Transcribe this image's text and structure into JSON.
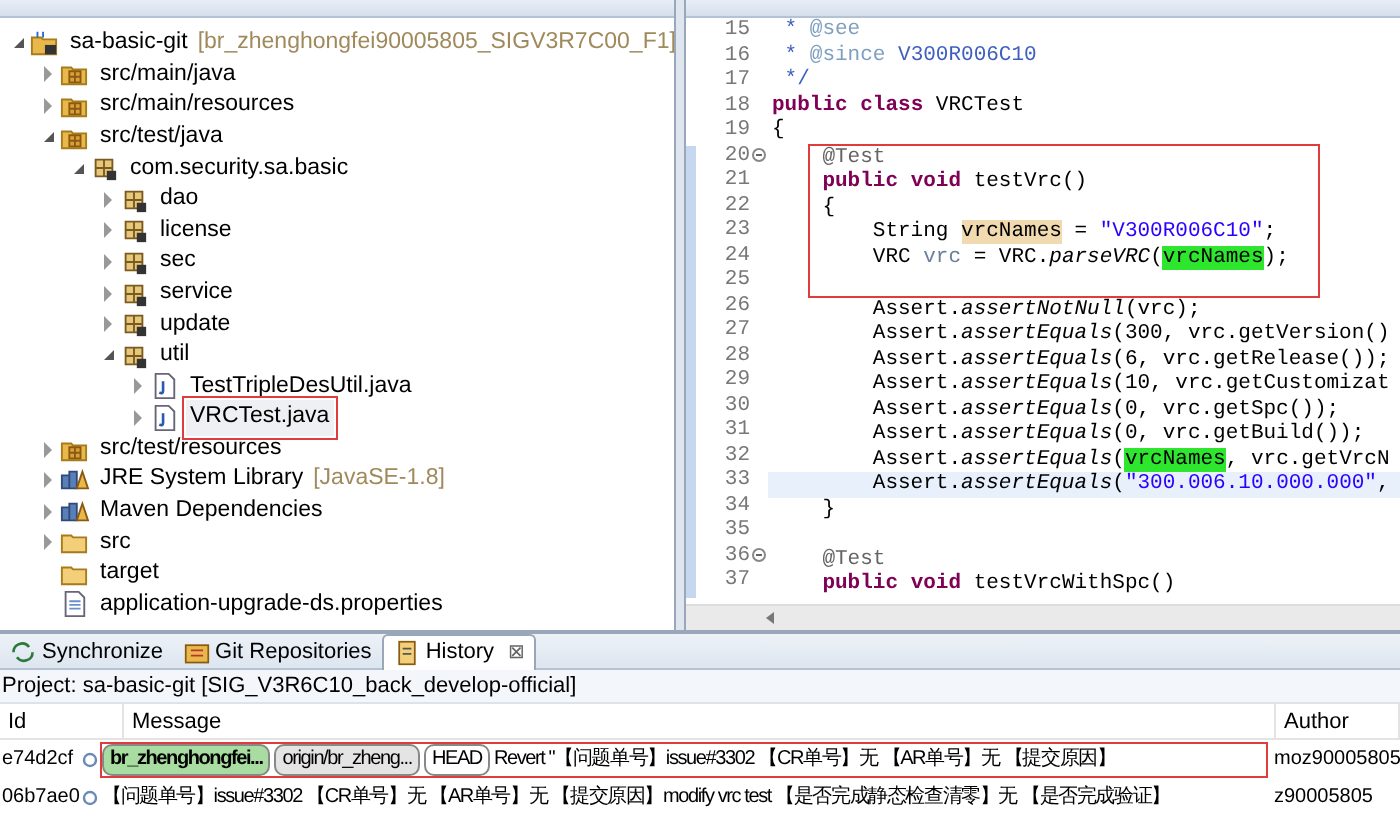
{
  "package_explorer": {
    "tree": [
      {
        "label": "sa-basic-git",
        "suffix": "[br_zhenghongfei90005805_SIGV3R7C00_F1]",
        "kind": "project",
        "expanded": true,
        "boxed": false,
        "children": [
          {
            "label": "src/main/java",
            "kind": "source-folder",
            "expanded": false,
            "boxed": false
          },
          {
            "label": "src/main/resources",
            "kind": "source-folder",
            "expanded": false,
            "boxed": false
          },
          {
            "label": "src/test/java",
            "kind": "source-folder",
            "expanded": true,
            "boxed": false,
            "children": [
              {
                "label": "com.security.sa.basic",
                "kind": "package",
                "expanded": true,
                "boxed": false,
                "children": [
                  {
                    "label": "dao",
                    "kind": "package",
                    "expanded": false,
                    "boxed": false
                  },
                  {
                    "label": "license",
                    "kind": "package",
                    "expanded": false,
                    "boxed": false
                  },
                  {
                    "label": "sec",
                    "kind": "package",
                    "expanded": false,
                    "boxed": false
                  },
                  {
                    "label": "service",
                    "kind": "package",
                    "expanded": false,
                    "boxed": false
                  },
                  {
                    "label": "update",
                    "kind": "package",
                    "expanded": false,
                    "boxed": false
                  },
                  {
                    "label": "util",
                    "kind": "package",
                    "expanded": true,
                    "boxed": false,
                    "children": [
                      {
                        "label": "TestTripleDesUtil.java",
                        "kind": "java-file",
                        "expanded": false,
                        "boxed": false
                      },
                      {
                        "label": "VRCTest.java",
                        "kind": "java-file",
                        "expanded": false,
                        "boxed": true
                      }
                    ]
                  }
                ]
              }
            ]
          },
          {
            "label": "src/test/resources",
            "kind": "source-folder",
            "expanded": false,
            "boxed": false
          },
          {
            "label": "JRE System Library",
            "suffix": "[JavaSE-1.8]",
            "kind": "library",
            "expanded": false,
            "boxed": false
          },
          {
            "label": "Maven Dependencies",
            "kind": "library",
            "expanded": false,
            "boxed": false
          },
          {
            "label": "src",
            "kind": "folder",
            "expanded": false,
            "boxed": false
          },
          {
            "label": "target",
            "kind": "folder",
            "boxed": false
          },
          {
            "label": "application-upgrade-ds.properties",
            "kind": "file",
            "boxed": false
          }
        ]
      }
    ]
  },
  "editor": {
    "lines": [
      {
        "number": "15",
        "tokens": [
          {
            "kind": "comment",
            "text": " * "
          },
          {
            "kind": "javadoc",
            "text": "@see"
          }
        ]
      },
      {
        "number": "16",
        "tokens": [
          {
            "kind": "comment",
            "text": " * "
          },
          {
            "kind": "javadoc",
            "text": "@since"
          },
          {
            "kind": "comment",
            "text": " V300R006C10"
          }
        ]
      },
      {
        "number": "17",
        "tokens": [
          {
            "kind": "comment",
            "text": " */"
          }
        ]
      },
      {
        "number": "18",
        "tokens": [
          {
            "kind": "keyword",
            "text": "public "
          },
          {
            "kind": "keyword",
            "text": "class"
          },
          {
            "kind": "plain",
            "text": " VRCTest"
          }
        ]
      },
      {
        "number": "19",
        "tokens": [
          {
            "kind": "plain",
            "text": "{"
          }
        ]
      },
      {
        "number": "20",
        "fold": true,
        "boxed": true,
        "tokens": [
          {
            "kind": "annotation",
            "text": "    @Test"
          }
        ]
      },
      {
        "number": "21",
        "boxed": true,
        "tokens": [
          {
            "kind": "keyword",
            "text": "    public "
          },
          {
            "kind": "keyword",
            "text": "void"
          },
          {
            "kind": "plain",
            "text": " testVrc()"
          }
        ]
      },
      {
        "number": "22",
        "boxed": true,
        "tokens": [
          {
            "kind": "plain",
            "text": "    {"
          }
        ]
      },
      {
        "number": "23",
        "boxed": true,
        "tokens": [
          {
            "kind": "plain",
            "text": "        String "
          },
          {
            "kind": "occurrence-write",
            "text": "vrcNames"
          },
          {
            "kind": "plain",
            "text": " = "
          },
          {
            "kind": "string",
            "text": "\"V300R006C10\""
          },
          {
            "kind": "plain",
            "text": ";"
          }
        ]
      },
      {
        "number": "24",
        "boxed": true,
        "tokens": [
          {
            "kind": "plain",
            "text": "        VRC "
          },
          {
            "kind": "local",
            "text": "vrc"
          },
          {
            "kind": "plain",
            "text": " = VRC."
          },
          {
            "kind": "static",
            "text": "parseVRC"
          },
          {
            "kind": "plain",
            "text": "("
          },
          {
            "kind": "occurrence",
            "text": "vrcNames"
          },
          {
            "kind": "plain",
            "text": ");"
          }
        ]
      },
      {
        "number": "25",
        "boxed": true
      },
      {
        "number": "26",
        "tokens": [
          {
            "kind": "plain",
            "text": "        Assert."
          },
          {
            "kind": "static",
            "text": "assertNotNull"
          },
          {
            "kind": "plain",
            "text": "(vrc);"
          }
        ]
      },
      {
        "number": "27",
        "tokens": [
          {
            "kind": "plain",
            "text": "        Assert."
          },
          {
            "kind": "static",
            "text": "assertEquals"
          },
          {
            "kind": "plain",
            "text": "(300, vrc.getVersion()"
          }
        ]
      },
      {
        "number": "28",
        "tokens": [
          {
            "kind": "plain",
            "text": "        Assert."
          },
          {
            "kind": "static",
            "text": "assertEquals"
          },
          {
            "kind": "plain",
            "text": "(6, vrc.getRelease());"
          }
        ]
      },
      {
        "number": "29",
        "tokens": [
          {
            "kind": "plain",
            "text": "        Assert."
          },
          {
            "kind": "static",
            "text": "assertEquals"
          },
          {
            "kind": "plain",
            "text": "(10, vrc.getCustomizat"
          }
        ]
      },
      {
        "number": "30",
        "tokens": [
          {
            "kind": "plain",
            "text": "        Assert."
          },
          {
            "kind": "static",
            "text": "assertEquals"
          },
          {
            "kind": "plain",
            "text": "(0, vrc.getSpc());"
          }
        ]
      },
      {
        "number": "31",
        "tokens": [
          {
            "kind": "plain",
            "text": "        Assert."
          },
          {
            "kind": "static",
            "text": "assertEquals"
          },
          {
            "kind": "plain",
            "text": "(0, vrc.getBuild());"
          }
        ]
      },
      {
        "number": "32",
        "tokens": [
          {
            "kind": "plain",
            "text": "        Assert."
          },
          {
            "kind": "static",
            "text": "assertEquals"
          },
          {
            "kind": "plain",
            "text": "("
          },
          {
            "kind": "occurrence",
            "text": "vrcNames"
          },
          {
            "kind": "plain",
            "text": ", vrc.getVrcN"
          }
        ]
      },
      {
        "number": "33",
        "current": true,
        "tokens": [
          {
            "kind": "plain",
            "text": "        Assert."
          },
          {
            "kind": "static",
            "text": "assertEquals"
          },
          {
            "kind": "plain",
            "text": "("
          },
          {
            "kind": "string",
            "text": "\"300.006.10.000.000\""
          },
          {
            "kind": "plain",
            "text": ","
          }
        ]
      },
      {
        "number": "34",
        "tokens": [
          {
            "kind": "plain",
            "text": "    }"
          }
        ]
      },
      {
        "number": "35"
      },
      {
        "number": "36",
        "fold": true,
        "tokens": [
          {
            "kind": "annotation",
            "text": "    @Test"
          }
        ]
      },
      {
        "number": "37",
        "tokens": [
          {
            "kind": "keyword",
            "text": "    public "
          },
          {
            "kind": "keyword",
            "text": "void"
          },
          {
            "kind": "plain",
            "text": " testVrcWithSpc()"
          }
        ]
      }
    ]
  },
  "bottom_tabs": [
    {
      "label": "Synchronize",
      "kind": "sync",
      "selected": false
    },
    {
      "label": "Git Repositories",
      "kind": "git",
      "selected": false
    },
    {
      "label": "History",
      "kind": "history",
      "selected": true,
      "close": "⊠"
    }
  ],
  "history": {
    "project": "Project: sa-basic-git [SIG_V3R6C10_back_develop-official]",
    "columns": [
      "Id",
      "Message",
      "Author"
    ],
    "rows": [
      {
        "id": "e74d2cf",
        "boxed": true,
        "refs": [
          {
            "label": "br_zhenghongfei...",
            "kind": "local"
          },
          {
            "label": "origin/br_zheng...",
            "kind": "remote"
          },
          {
            "label": "HEAD",
            "kind": "head"
          }
        ],
        "message": "Revert \"【问题单号】issue#3302 【CR单号】无 【AR单号】无 【提交原因】",
        "author": "moz90005805"
      },
      {
        "id": "06b7ae0",
        "boxed": false,
        "message": "【问题单号】issue#3302 【CR单号】无 【AR单号】无 【提交原因】modify vrc test 【是否完成静态检查清零】无 【是否完成验证】",
        "author": "z90005805"
      }
    ]
  }
}
